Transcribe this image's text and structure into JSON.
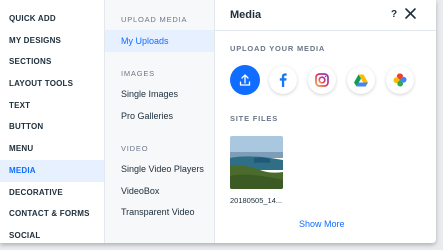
{
  "nav": {
    "items": [
      {
        "label": "QUICK ADD"
      },
      {
        "label": "MY DESIGNS"
      },
      {
        "label": "SECTIONS"
      },
      {
        "label": "LAYOUT TOOLS"
      },
      {
        "label": "TEXT"
      },
      {
        "label": "BUTTON"
      },
      {
        "label": "MENU"
      },
      {
        "label": "MEDIA",
        "active": true
      },
      {
        "label": "DECORATIVE"
      },
      {
        "label": "CONTACT & FORMS"
      },
      {
        "label": "SOCIAL"
      }
    ]
  },
  "sub": {
    "upload_heading": "UPLOAD MEDIA",
    "my_uploads": "My Uploads",
    "images_heading": "IMAGES",
    "single_images": "Single Images",
    "pro_galleries": "Pro Galleries",
    "video_heading": "VIDEO",
    "single_video_players": "Single Video Players",
    "videobox": "VideoBox",
    "transparent_video": "Transparent Video"
  },
  "panel": {
    "title": "Media",
    "help": "?",
    "upload_label": "UPLOAD YOUR MEDIA",
    "site_files_label": "SITE FILES",
    "file_name": "20180505_14...",
    "show_more": "Show More"
  },
  "colors": {
    "accent": "#116dff",
    "active_bg": "#e7f0ff",
    "facebook": "#1877f2"
  },
  "icons": [
    "upload-icon",
    "facebook-icon",
    "instagram-icon",
    "google-drive-icon",
    "google-photos-icon",
    "close-icon",
    "help-icon"
  ]
}
